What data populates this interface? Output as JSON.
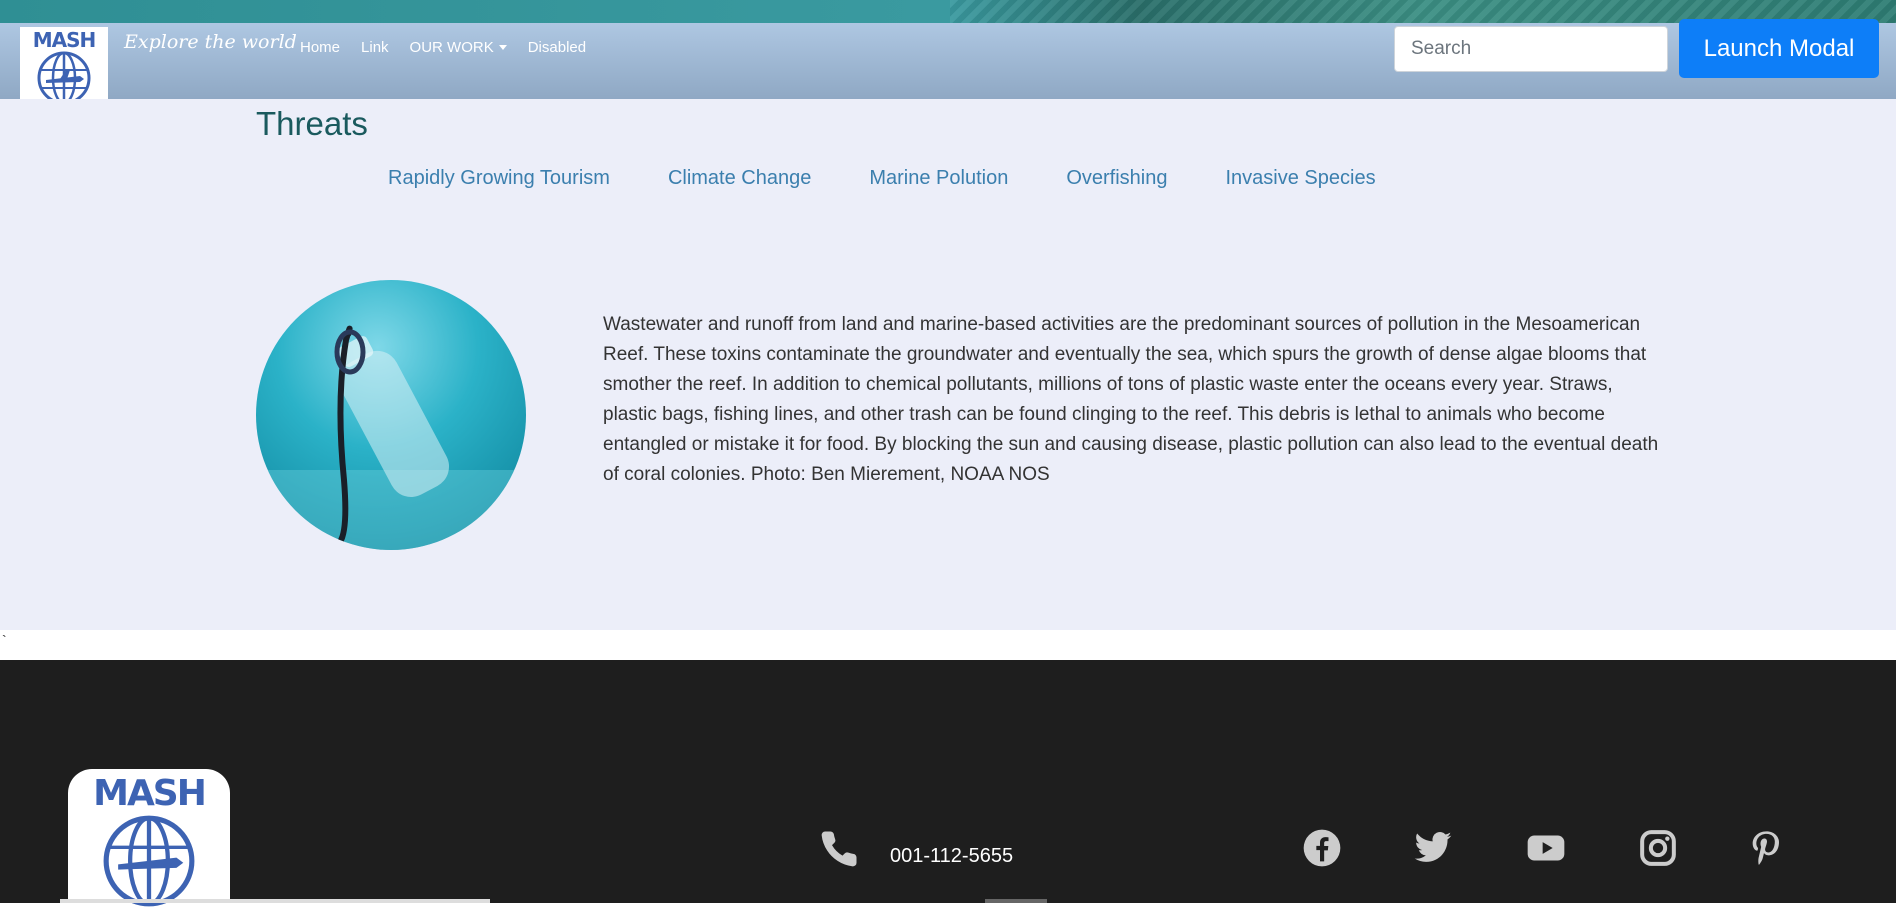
{
  "header": {
    "logo_text": "MASH",
    "tagline": "Explore the world",
    "nav": {
      "home": "Home",
      "link": "Link",
      "our_work": "OUR WORK",
      "disabled": "Disabled"
    },
    "search_placeholder": "Search",
    "modal_button": "Launch Modal"
  },
  "main": {
    "title": "Threats",
    "tabs": [
      "Rapidly Growing Tourism",
      "Climate Change",
      "Marine Polution",
      "Overfishing",
      "Invasive Species"
    ],
    "description": "Wastewater and runoff from land and marine-based activities are the predominant sources of pollution in the Mesoamerican Reef. These toxins contaminate the groundwater and eventually the sea, which spurs the growth of dense algae blooms that smother the reef. In addition to chemical pollutants, millions of tons of plastic waste enter the oceans every year. Straws, plastic bags, fishing lines, and other trash can be found clinging to the reef. This debris is lethal to animals who become entangled or mistake it for food. By blocking the sun and causing disease, plastic pollution can also lead to the eventual death of coral colonies. Photo: Ben Mierement, NOAA NOS",
    "stray_char": "`"
  },
  "footer": {
    "logo_text": "MASH",
    "phone": "001-112-5655",
    "icons": [
      "phone-icon",
      "facebook-icon",
      "twitter-icon",
      "youtube-icon",
      "instagram-icon",
      "pinterest-icon"
    ]
  },
  "colors": {
    "navbar": "#9fb8d4",
    "button": "#0d7ef8",
    "title": "#1a5a5e",
    "tab_link": "#3b7fae",
    "footer_bg": "#1e1e1e"
  }
}
